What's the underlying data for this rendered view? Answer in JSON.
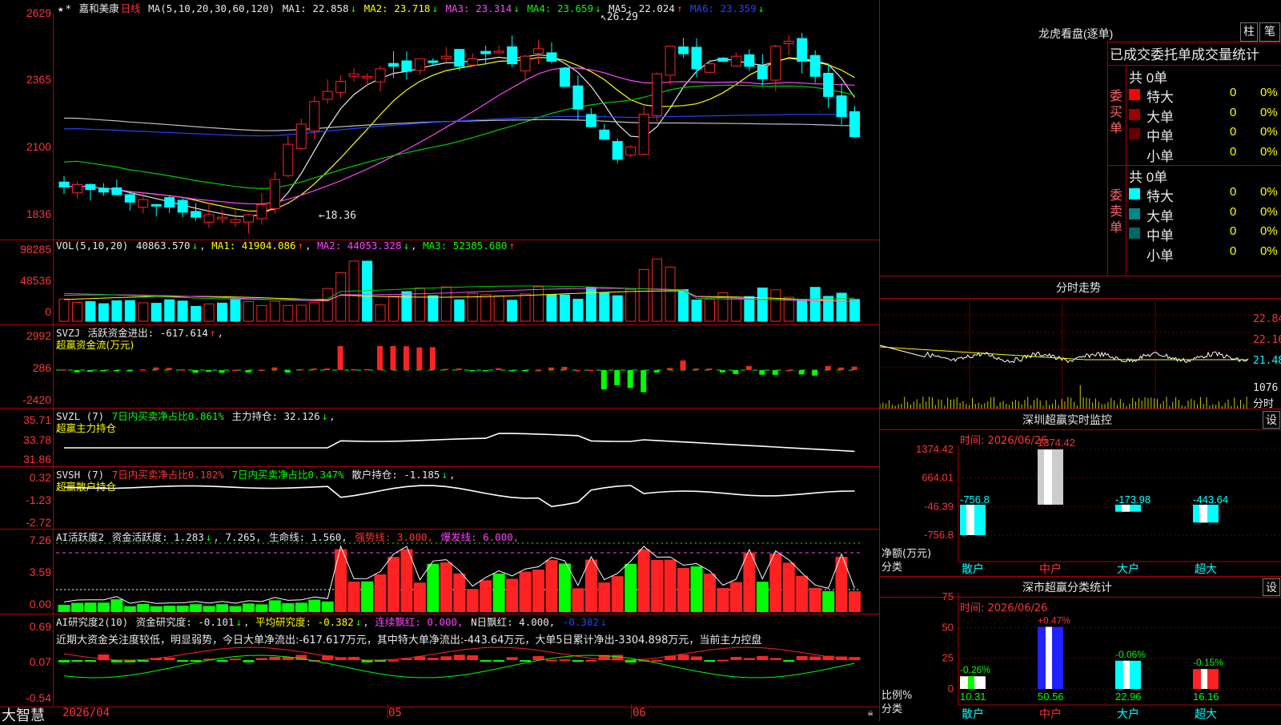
{
  "main": {
    "stock_name": "嘉和美康",
    "period": "日线",
    "ma_params": "MA(5,10,20,30,60,120)",
    "ma": [
      {
        "label": "MA1:",
        "value": "22.858",
        "arrow": "↓",
        "color": "#e8e8e8"
      },
      {
        "label": "MA2:",
        "value": "23.718",
        "arrow": "↓",
        "color": "#ffff00"
      },
      {
        "label": "MA3:",
        "value": "23.314",
        "arrow": "↓",
        "color": "#ff44ff"
      },
      {
        "label": "MA4:",
        "value": "23.659",
        "arrow": "↓",
        "color": "#00ff00"
      },
      {
        "label": "MA5:",
        "value": "22.024",
        "arrow": "↑",
        "color": "#e8e8e8"
      },
      {
        "label": "MA6:",
        "value": "23.359",
        "arrow": "↓",
        "color": "#2244ff"
      }
    ],
    "y_ticks": [
      "2629",
      "2365",
      "2100",
      "1836"
    ],
    "high_mark": "26.29",
    "low_mark": "←18.36"
  },
  "vol": {
    "header": "VOL(5,10,20)",
    "value": "40863.570",
    "ma1": "MA1: 41904.086",
    "ma2": "MA2: 44053.328",
    "ma3": "MA3: 52385.680",
    "y_ticks": [
      "98285",
      "48536",
      "0"
    ]
  },
  "svzj": {
    "header": "SVZJ",
    "label": "活跃资金进出: -617.614",
    "sub": "超赢资金流(万元)",
    "y_ticks": [
      "2992",
      "286",
      "-2420"
    ]
  },
  "svzl": {
    "header": "SVZL (7)",
    "label1": "7日内买卖净占比0.861%",
    "label2": "主力持仓: 32.126",
    "sub": "超赢主力持仓",
    "y_ticks": [
      "35.71",
      "33.78",
      "31.86"
    ]
  },
  "svsh": {
    "header": "SVSH (7)",
    "label1": "7日内买卖净占比0.182%",
    "label2": "7日内买卖净占比0.347%",
    "label3": "散户持仓: -1.185",
    "sub": "超赢散户持仓",
    "y_ticks": [
      "0.32",
      "-1.23",
      "-2.72"
    ]
  },
  "ai1": {
    "header": "AI活跃度2",
    "label1": "资金活跃度: 1.283",
    "label2": "7.265,",
    "label3": "生命线: 1.560,",
    "label4": "强势线: 3.000,",
    "label5": "爆发线: 6.000,",
    "y_ticks": [
      "7.26",
      "3.59",
      "0.00"
    ]
  },
  "ai2": {
    "header": "AI研究度2(10)",
    "label1": "资金研究度: -0.101",
    "label2": "平均研究度: -0.382",
    "label3": "连续飘红: 0.000,",
    "label4": "N日飘红: 4.000,",
    "label5": "-0.382",
    "comment": "近期大资金关注度较低，明显弱势，今日大单净流出:-617.617万元，其中特大单净流出:-443.64万元，大单5日累计净出-3304.898万元，当前主力控盘",
    "y_ticks": [
      "0.69",
      "0.07",
      "-0.54"
    ]
  },
  "xaxis": {
    "date": "2026/04",
    "m5": "05",
    "m6": "06"
  },
  "brand": "大智慧",
  "right": {
    "lhkp_title": "龙虎看盘(逐单)",
    "btn_zhu": "柱",
    "btn_bi": "笔",
    "table_header": "已成交委托单成交量统计",
    "buy": {
      "side": "委买单",
      "count": "共 0单",
      "rows": [
        {
          "name": "特大",
          "color": "#ff0000",
          "vol": "0",
          "pct": "0%"
        },
        {
          "name": "大单",
          "color": "#990000",
          "vol": "0",
          "pct": "0%"
        },
        {
          "name": "中单",
          "color": "#660000",
          "vol": "0",
          "pct": "0%"
        },
        {
          "name": "小单",
          "color": "",
          "vol": "0",
          "pct": "0%"
        }
      ]
    },
    "sell": {
      "side": "委卖单",
      "count": "共 0单",
      "rows": [
        {
          "name": "特大",
          "color": "#00ffff",
          "vol": "0",
          "pct": "0%"
        },
        {
          "name": "大单",
          "color": "#008888",
          "vol": "0",
          "pct": "0%"
        },
        {
          "name": "中单",
          "color": "#006666",
          "vol": "0",
          "pct": "0%"
        },
        {
          "name": "小单",
          "color": "",
          "vol": "0",
          "pct": "0%"
        }
      ]
    },
    "fenshi_title": "分时走势",
    "fenshi_ticks": [
      "22.84",
      "22.16",
      "21.48",
      "1076",
      "分时"
    ],
    "sz_title": "深圳超赢实时监控",
    "sz_btn": "设",
    "sz_time": "时间: 2026/06/26",
    "sz_y": [
      "1374.42",
      "664.01",
      "-46.39",
      "-756.8"
    ],
    "sz_bars": [
      {
        "cat": "散户",
        "value": -756.8,
        "label": "-756.8",
        "color": "#00ffff"
      },
      {
        "cat": "中户",
        "value": 1374.42,
        "label": "1374.42",
        "color": "#cccccc"
      },
      {
        "cat": "大户",
        "value": -173.98,
        "label": "-173.98",
        "color": "#00ffff"
      },
      {
        "cat": "超大",
        "value": -443.64,
        "label": "-443.64",
        "color": "#00ffff"
      }
    ],
    "sz_ylabel": "净额(万元)",
    "sz_xlabel": "分类",
    "cls_title": "深市超赢分类统计",
    "cls_btn": "设",
    "cls_time": "时间: 2026/06/26",
    "cls_y": [
      "75",
      "50",
      "25",
      "0"
    ],
    "cls_bars": [
      {
        "cat": "散户",
        "value": 10.31,
        "label": "10.31",
        "change": "-0.26%",
        "color": "#ffffff",
        "stripe": "#00ff00"
      },
      {
        "cat": "中户",
        "value": 50.56,
        "label": "50.56",
        "change": "+0.47%",
        "color": "#2222ff",
        "stripe": "#ffffff"
      },
      {
        "cat": "大户",
        "value": 22.96,
        "label": "22.96",
        "change": "-0.06%",
        "color": "#00ffff",
        "stripe": "#ffffff"
      },
      {
        "cat": "超大",
        "value": 16.16,
        "label": "16.16",
        "change": "-0.15%",
        "color": "#ff2222",
        "stripe": "#ffffff"
      }
    ],
    "cls_ylabel": "比例%",
    "cls_xlabel": "分类"
  },
  "chart_data": {
    "type": "bar",
    "title": "",
    "categories": [
      "散户",
      "中户",
      "大户",
      "超大"
    ],
    "series": [
      {
        "name": "净额(万元)",
        "values": [
          -756.8,
          1374.42,
          -173.98,
          -443.64
        ]
      },
      {
        "name": "比例%",
        "values": [
          10.31,
          50.56,
          22.96,
          16.16
        ]
      }
    ]
  }
}
